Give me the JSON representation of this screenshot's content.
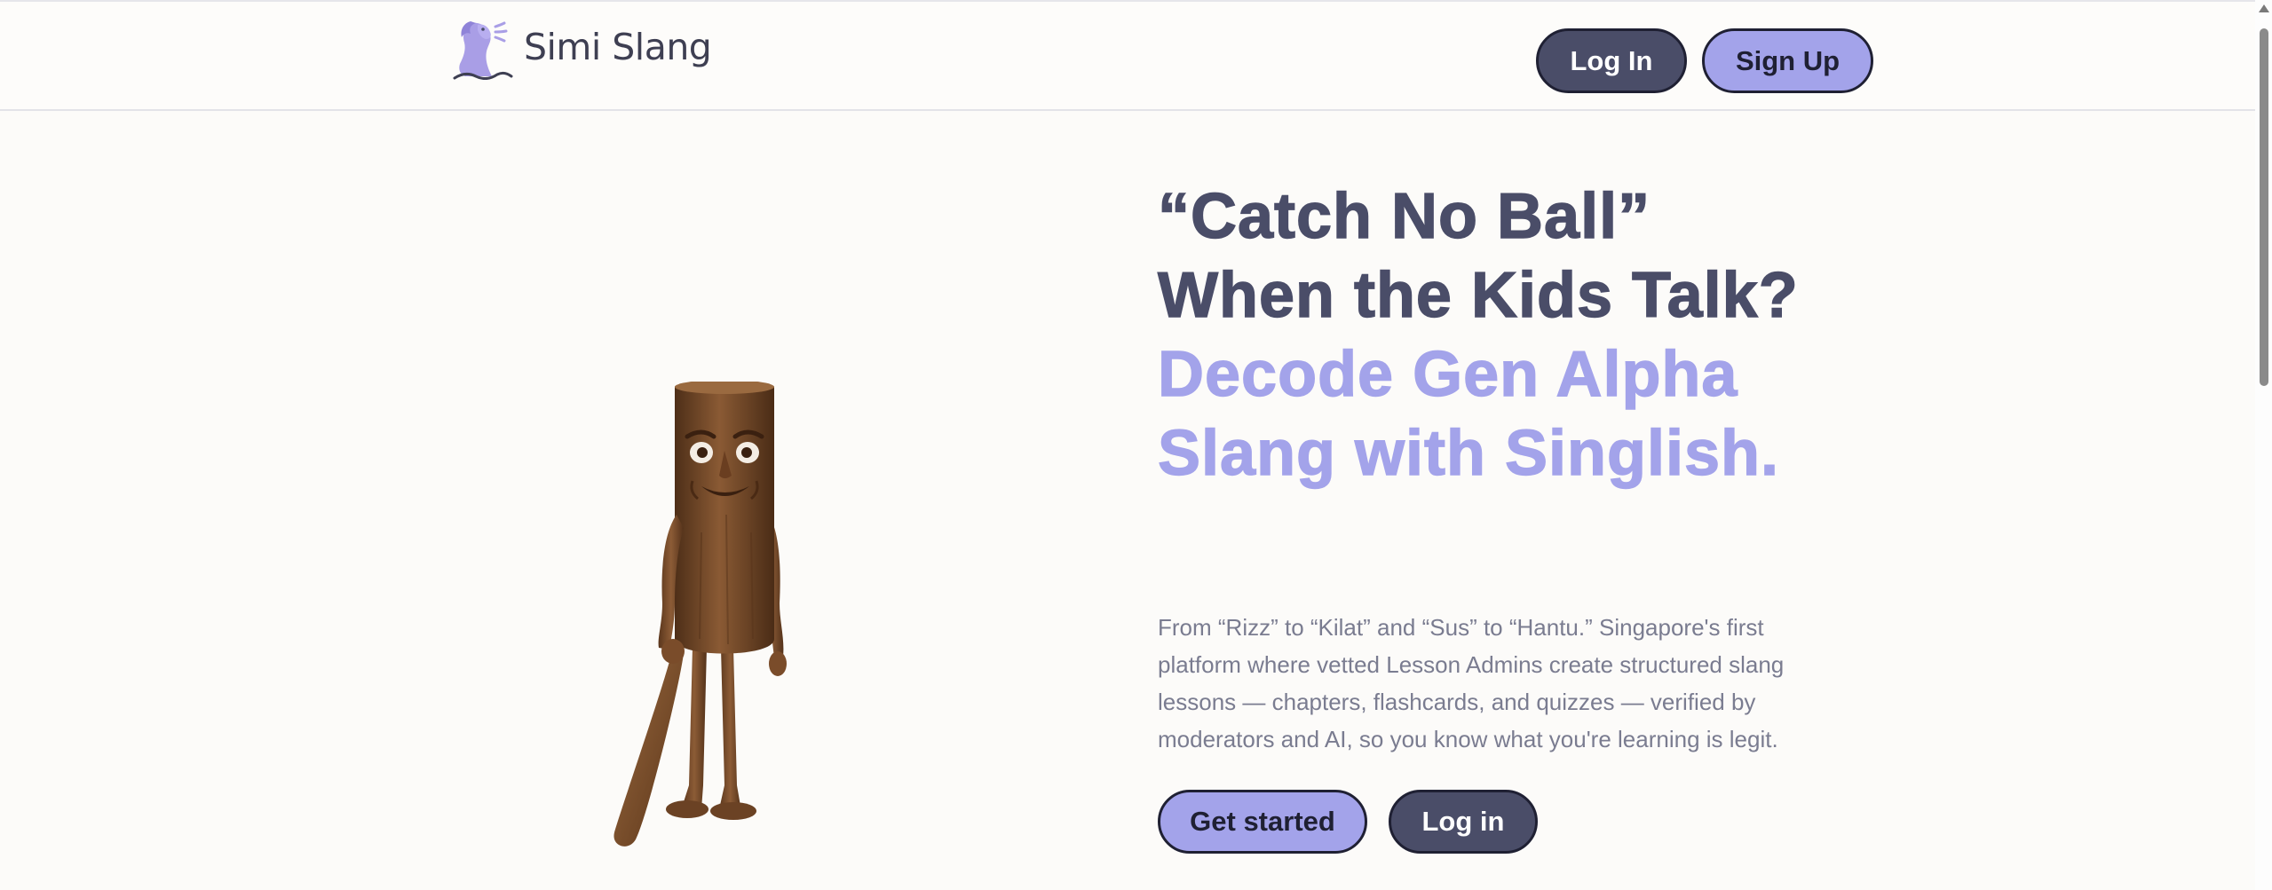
{
  "header": {
    "brand_name": "Simi Slang",
    "login_label": "Log In",
    "signup_label": "Sign Up"
  },
  "hero": {
    "headline_main": "“Catch No Ball” When the Kids Talk?",
    "headline_accent": "Decode Gen Alpha Slang with Singlish.",
    "description": "From “Rizz” to “Kilat” and “Sus” to “Hantu.” Singapore's first platform where vetted Lesson Admins create structured slang lessons — chapters, flashcards, and quizzes — verified by moderators and AI, so you know what you're learning is legit.",
    "primary_cta": "Get started",
    "secondary_cta": "Log in"
  },
  "icons": {
    "logo": "merlion-logo",
    "hero_image": "wooden-character-with-bat"
  },
  "colors": {
    "dark_navy": "#4a4d68",
    "lavender_accent": "#a3a3ea",
    "background": "#fcfbf9",
    "body_text": "#7a7c90"
  }
}
